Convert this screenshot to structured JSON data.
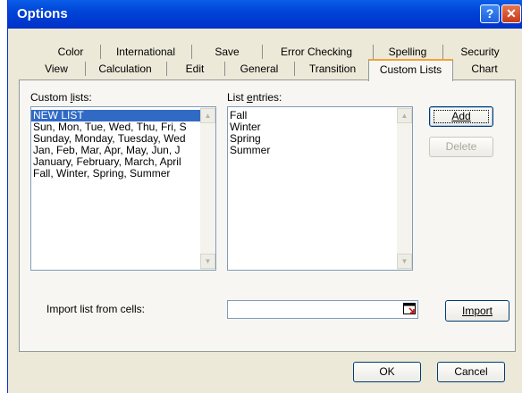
{
  "window": {
    "title": "Options",
    "help_glyph": "?",
    "close_glyph": "✕"
  },
  "tabs_row1": [
    "Color",
    "International",
    "Save",
    "Error Checking",
    "Spelling",
    "Security"
  ],
  "tabs_row2": [
    "View",
    "Calculation",
    "Edit",
    "General",
    "Transition",
    "Custom Lists",
    "Chart"
  ],
  "active_tab": "Custom Lists",
  "custom_lists": {
    "label_prefix": "Custom ",
    "label_accel": "l",
    "label_suffix": "ists:",
    "items": [
      "NEW LIST",
      "Sun, Mon, Tue, Wed, Thu, Fri, S",
      "Sunday, Monday, Tuesday, Wed",
      "Jan, Feb, Mar, Apr, May, Jun, J",
      "January, February, March, April",
      "Fall, Winter, Spring, Summer"
    ],
    "selected_index": 0
  },
  "list_entries": {
    "label_prefix": "List ",
    "label_accel": "e",
    "label_suffix": "ntries:",
    "items": [
      "Fall",
      "Winter",
      "Spring",
      "Summer"
    ]
  },
  "buttons": {
    "add": "Add",
    "delete": "Delete",
    "import": "Import",
    "ok": "OK",
    "cancel": "Cancel"
  },
  "import": {
    "label_prefix": "Import list from cells:",
    "value": ""
  },
  "colors": {
    "title_bar": "#0044d8",
    "selection": "#316ac5",
    "dialog_bg": "#ece9d8",
    "active_tab_accent": "#f0a23a"
  },
  "icons": {
    "collapse": "collapse-dialog-icon",
    "scroll_up": "scroll-up-arrow",
    "scroll_down": "scroll-down-arrow"
  }
}
